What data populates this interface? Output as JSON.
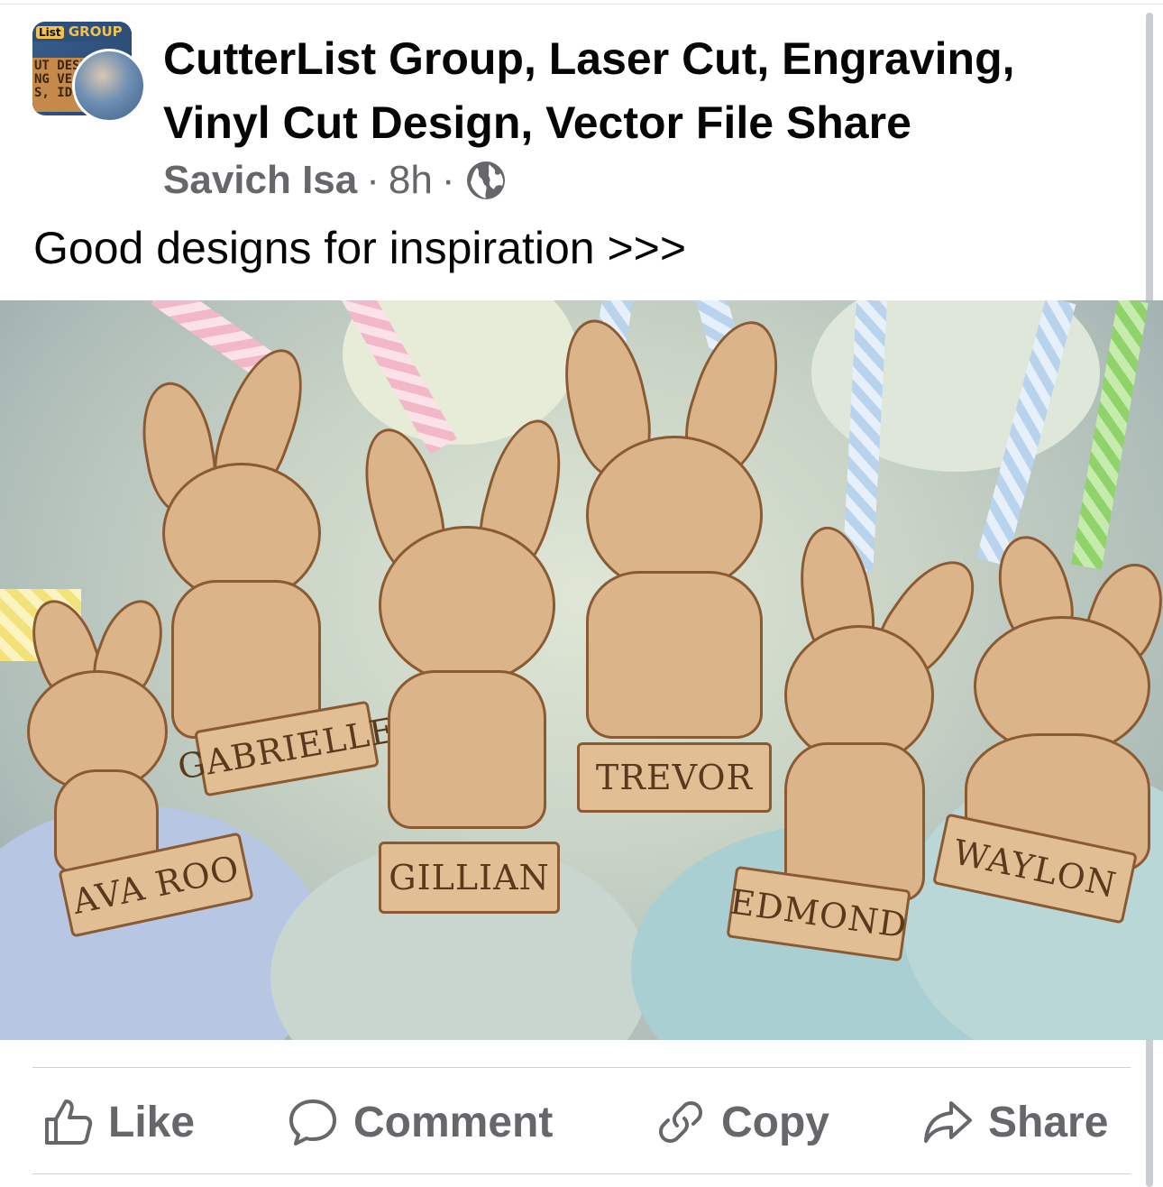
{
  "group": {
    "avatar_band_left": "List",
    "avatar_band_right": "GROUP",
    "avatar_sign_lines": [
      "UT DESI",
      "NG VEC",
      "S, IDEAS"
    ],
    "title": "CutterList Group, Laser Cut, Engraving, Vinyl Cut Design, Vector File Share"
  },
  "post": {
    "author": "Savich Isa",
    "separator": "·",
    "time": "8h",
    "privacy_icon": "globe-icon",
    "text": "Good designs for inspiration >>>"
  },
  "photo": {
    "tags": [
      {
        "name": "AVA ROO"
      },
      {
        "name": "GABRIELLE"
      },
      {
        "name": "GILLIAN"
      },
      {
        "name": "TREVOR"
      },
      {
        "name": "EDMOND"
      },
      {
        "name": "WAYLON"
      }
    ],
    "colors": {
      "wood": "#dcb48a",
      "engrave": "#8a5a32",
      "ribbon_pink": "#f2b8c8",
      "ribbon_blue": "#b9d3ec",
      "ribbon_green": "#8fd36a",
      "ribbon_yellow": "#f3e27a"
    }
  },
  "actions": {
    "like": {
      "label": "Like",
      "icon": "thumbs-up-icon"
    },
    "comment": {
      "label": "Comment",
      "icon": "comment-bubble-icon"
    },
    "copy": {
      "label": "Copy",
      "icon": "link-icon"
    },
    "share": {
      "label": "Share",
      "icon": "share-arrow-icon"
    }
  },
  "colors": {
    "text_primary": "#050505",
    "text_secondary": "#65676b",
    "divider": "#ced0d4"
  }
}
